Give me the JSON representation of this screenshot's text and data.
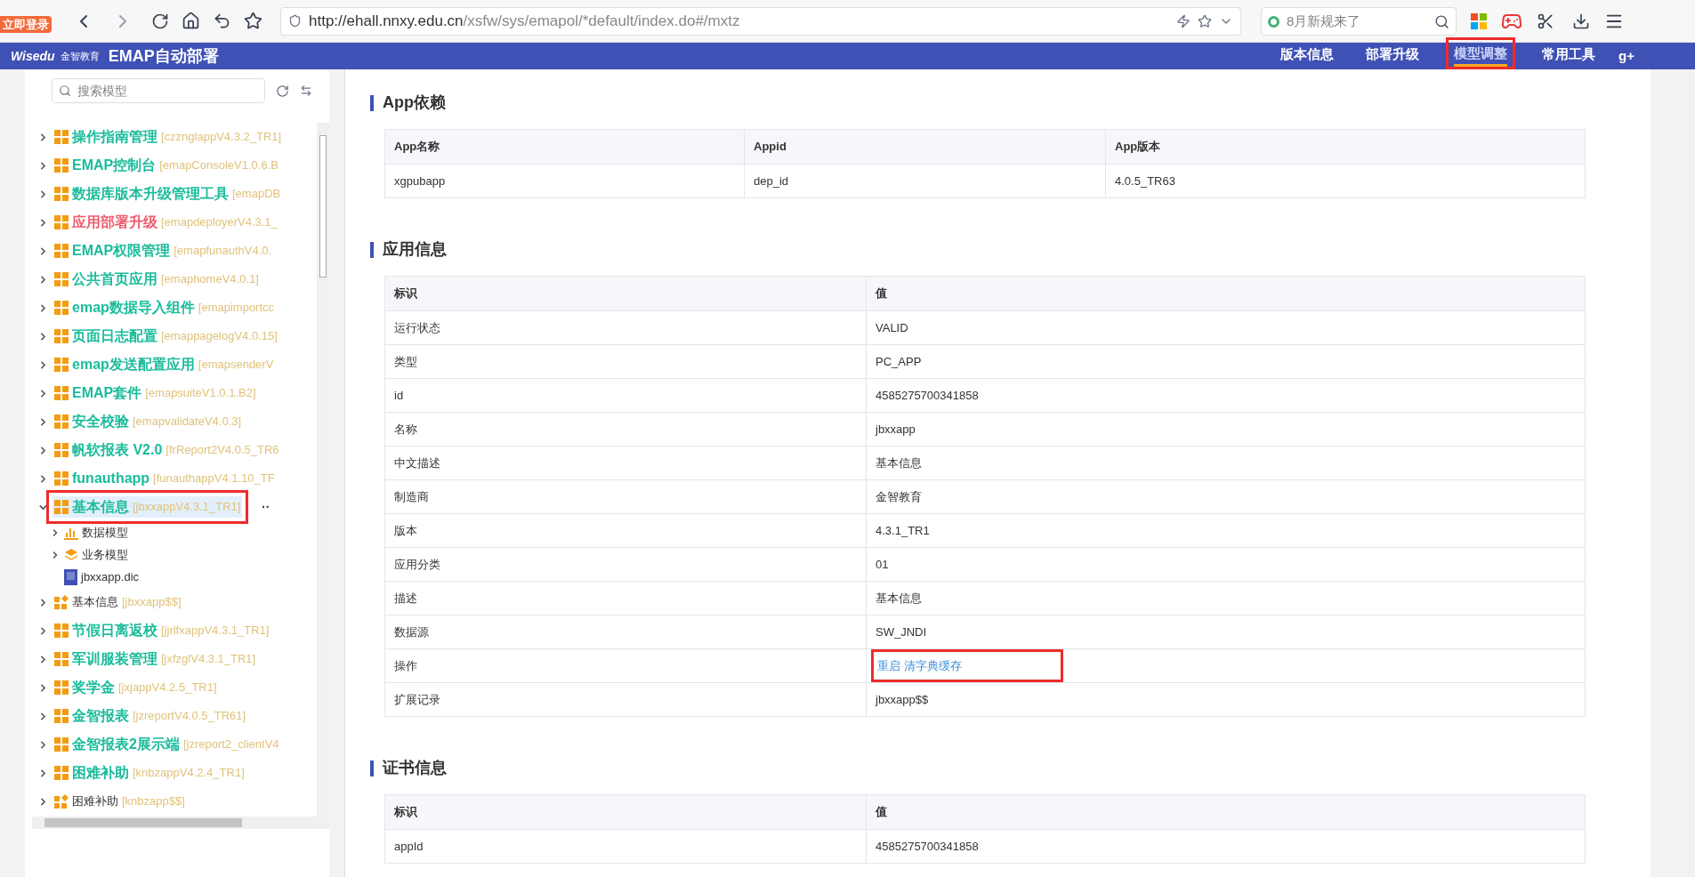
{
  "browser": {
    "login_badge": "立即登录",
    "url_host": "http://ehall.nnxy.edu.cn",
    "url_path": "/xsfw/sys/emapol/*default/index.do#/mxtz",
    "search": {
      "placeholder": "8月新规来了"
    }
  },
  "header": {
    "brand": "Wisedu",
    "brand_sub": "金智教育",
    "title": "EMAP自动部署",
    "tabs": [
      {
        "label": "版本信息",
        "selected": false
      },
      {
        "label": "部署升级",
        "selected": false
      },
      {
        "label": "模型调整",
        "selected": true,
        "annotated": true
      },
      {
        "label": "常用工具",
        "selected": false
      }
    ],
    "share": "g+"
  },
  "sidebar": {
    "search": {
      "placeholder": "搜索模型"
    },
    "tree": [
      {
        "kind": "app",
        "name": "操作指南管理",
        "code": "[czznglappV4.3.2_TR1]",
        "color": "#1bbc9b",
        "expanded": false,
        "selected": false
      },
      {
        "kind": "app",
        "name": "EMAP控制台",
        "code": "[emapConsoleV1.0.6.B",
        "color": "#1bbc9b",
        "expanded": false,
        "selected": false
      },
      {
        "kind": "app",
        "name": "数据库版本升级管理工具",
        "code": "[emapDB",
        "color": "#1bbc9b",
        "expanded": false,
        "selected": false
      },
      {
        "kind": "app",
        "name": "应用部署升级",
        "code": "[emapdeployerV4.3.1_",
        "color": "#ef5b6b",
        "expanded": false,
        "selected": false
      },
      {
        "kind": "app",
        "name": "EMAP权限管理",
        "code": "[emapfunauthV4.0.",
        "color": "#1bbc9b",
        "expanded": false,
        "selected": false
      },
      {
        "kind": "app",
        "name": "公共首页应用",
        "code": "[emaphomeV4.0.1]",
        "color": "#1bbc9b",
        "expanded": false,
        "selected": false
      },
      {
        "kind": "app",
        "name": "emap数据导入组件",
        "code": "[emapimportcc",
        "color": "#1bbc9b",
        "expanded": false,
        "selected": false
      },
      {
        "kind": "app",
        "name": "页面日志配置",
        "code": "[emappagelogV4.0.15]",
        "color": "#1bbc9b",
        "expanded": false,
        "selected": false
      },
      {
        "kind": "app",
        "name": "emap发送配置应用",
        "code": "[emapsenderV",
        "color": "#1bbc9b",
        "expanded": false,
        "selected": false
      },
      {
        "kind": "app",
        "name": "EMAP套件",
        "code": "[emapsuiteV1.0.1.B2]",
        "color": "#1bbc9b",
        "expanded": false,
        "selected": false
      },
      {
        "kind": "app",
        "name": "安全校验",
        "code": "[emapvalidateV4.0.3]",
        "color": "#1bbc9b",
        "expanded": false,
        "selected": false
      },
      {
        "kind": "app",
        "name": "帆软报表 V2.0",
        "code": "[frReport2V4.0.5_TR6",
        "color": "#1bbc9b",
        "expanded": false,
        "selected": false
      },
      {
        "kind": "app",
        "name": "funauthapp",
        "code": "[funauthappV4.1.10_TF",
        "color": "#1bbc9b",
        "expanded": false,
        "selected": false
      },
      {
        "kind": "app",
        "name": "基本信息",
        "code": "[jbxxappV4.3.1_TR1]",
        "color": "#1bbc9b",
        "expanded": true,
        "selected": true,
        "annotated": true,
        "more": "··",
        "children": [
          {
            "kind": "data-model",
            "name": "数据模型",
            "expandable": true
          },
          {
            "kind": "business-model",
            "name": "业务模型",
            "expandable": true
          },
          {
            "kind": "file",
            "name": "jbxxapp.dic",
            "expandable": false
          }
        ]
      },
      {
        "kind": "ext",
        "name": "基本信息",
        "code": "[jbxxapp$$]",
        "expanded": false,
        "selected": false
      },
      {
        "kind": "app",
        "name": "节假日离返校",
        "code": "[jjrlfxappV4.3.1_TR1]",
        "color": "#1bbc9b",
        "expanded": false,
        "selected": false
      },
      {
        "kind": "app",
        "name": "军训服装管理",
        "code": "[jxfzglV4.3.1_TR1]",
        "color": "#1bbc9b",
        "expanded": false,
        "selected": false
      },
      {
        "kind": "app",
        "name": "奖学金",
        "code": "[jxjappV4.2.5_TR1]",
        "color": "#1bbc9b",
        "expanded": false,
        "selected": false
      },
      {
        "kind": "app",
        "name": "金智报表",
        "code": "[jzreportV4.0.5_TR61]",
        "color": "#1bbc9b",
        "expanded": false,
        "selected": false
      },
      {
        "kind": "app",
        "name": "金智报表2展示端",
        "code": "[jzreport2_clientV4",
        "color": "#1bbc9b",
        "expanded": false,
        "selected": false
      },
      {
        "kind": "app",
        "name": "困难补助",
        "code": "[knbzappV4.2.4_TR1]",
        "color": "#1bbc9b",
        "expanded": false,
        "selected": false
      },
      {
        "kind": "ext",
        "name": "困难补助",
        "code": "[knbzapp$$]",
        "expanded": false,
        "selected": false
      }
    ]
  },
  "sections": [
    {
      "title": "App依赖",
      "columns": [
        "App名称",
        "Appid",
        "App版本"
      ],
      "rows": [
        [
          "xgpubapp",
          "dep_id",
          "4.0.5_TR63"
        ]
      ]
    },
    {
      "title": "应用信息",
      "columns": [
        "标识",
        "值"
      ],
      "rows": [
        [
          "运行状态",
          "VALID"
        ],
        [
          "类型",
          "PC_APP"
        ],
        [
          "id",
          "4585275700341858"
        ],
        [
          "名称",
          "jbxxapp"
        ],
        [
          "中文描述",
          "基本信息"
        ],
        [
          "制造商",
          "金智教育"
        ],
        [
          "版本",
          "4.3.1_TR1"
        ],
        [
          "应用分类",
          "01"
        ],
        [
          "描述",
          "基本信息"
        ],
        [
          "数据源",
          "SW_JNDI"
        ]
      ],
      "action_row": {
        "label": "操作",
        "links": [
          "重启",
          "清字典缓存"
        ],
        "annotated": true
      },
      "rows_after": [
        [
          "扩展记录",
          "jbxxapp$$"
        ]
      ]
    },
    {
      "title": "证书信息",
      "columns": [
        "标识",
        "值"
      ],
      "rows": [
        [
          "appId",
          "4585275700341858"
        ]
      ]
    }
  ]
}
